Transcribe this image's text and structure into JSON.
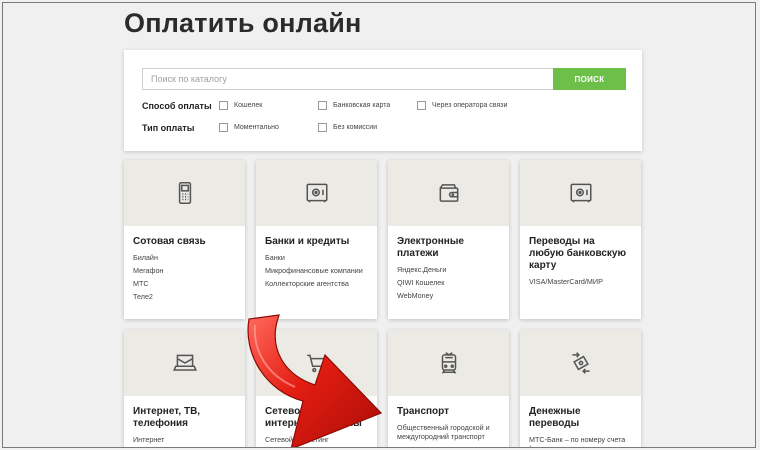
{
  "page": {
    "title": "Оплатить онлайн"
  },
  "search": {
    "placeholder": "Поиск по каталогу",
    "button_label": "ПОИСК"
  },
  "filters": {
    "payment_method_label": "Способ оплаты",
    "payment_method_options": [
      "Кошелек",
      "Банковская карта",
      "Через оператора связи"
    ],
    "payment_type_label": "Тип оплаты",
    "payment_type_options": [
      "Моментально",
      "Без комиссии"
    ]
  },
  "categories": [
    {
      "title": "Сотовая связь",
      "icon": "mobile-phone-icon",
      "links": [
        "Билайн",
        "Мегафон",
        "МТС",
        "Теле2"
      ]
    },
    {
      "title": "Банки и кредиты",
      "icon": "safe-icon",
      "links": [
        "Банки",
        "Микрофинансовые компании",
        "Коллекторские агентства"
      ]
    },
    {
      "title": "Электронные платежи",
      "icon": "wallet-icon",
      "links": [
        "Яндекс.Деньги",
        "QIWI Кошелек",
        "WebMoney"
      ]
    },
    {
      "title": "Переводы на любую банковскую карту",
      "icon": "safe-icon",
      "links": [
        "VISA/MasterCard/МИР"
      ]
    },
    {
      "title": "Интернет, ТВ, телефония",
      "icon": "laptop-icon",
      "links": [
        "Интернет"
      ]
    },
    {
      "title": "Сетевой маркетинг, интернет-магазины",
      "icon": "shopping-cart-icon",
      "links": [
        "Сетевой маркетинг"
      ]
    },
    {
      "title": "Транспорт",
      "icon": "train-icon",
      "links": [
        "Общественный городской и междугородний транспорт"
      ]
    },
    {
      "title": "Денежные переводы",
      "icon": "money-transfer-icon",
      "links": [
        "МТС-Банк – по номеру счета (по реквизитам платежного поручения)"
      ]
    }
  ],
  "colors": {
    "accent_green": "#6cc04a",
    "arrow_red": "#e41d12",
    "thumb_bg": "#ebeae5",
    "page_bg": "#f0f0f0"
  }
}
